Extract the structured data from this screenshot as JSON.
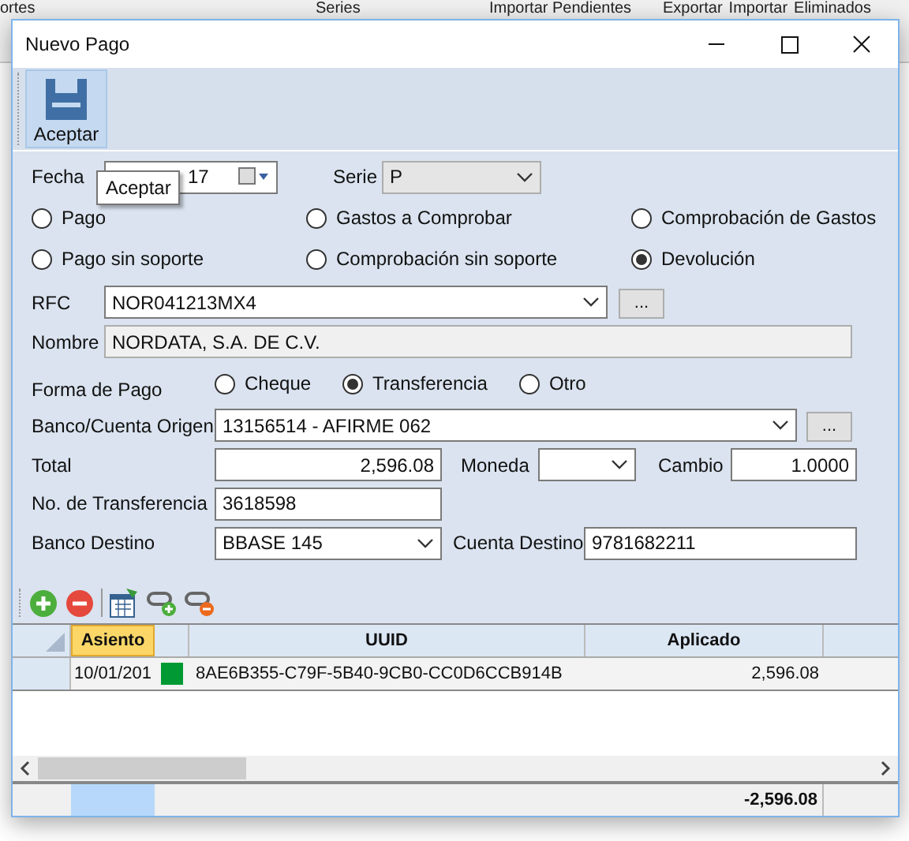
{
  "background": {
    "toolbar": [
      "ortes",
      "Series",
      "Importar Pendientes",
      "Exportar",
      "Importar",
      "Eliminados"
    ]
  },
  "window": {
    "title": "Nuevo Pago"
  },
  "toolbar": {
    "buttons": [
      {
        "label": "Aceptar"
      }
    ],
    "tooltip": "Aceptar"
  },
  "fecha": {
    "label": "Fecha",
    "value": "17"
  },
  "serie": {
    "label": "Serie",
    "value": "P"
  },
  "tipo_options": [
    {
      "label": "Pago",
      "selected": false
    },
    {
      "label": "Gastos a Comprobar",
      "selected": false
    },
    {
      "label": "Comprobación de Gastos",
      "selected": false
    },
    {
      "label": "Pago sin soporte",
      "selected": false
    },
    {
      "label": "Comprobación sin soporte",
      "selected": false
    },
    {
      "label": "Devolución",
      "selected": true
    }
  ],
  "rfc": {
    "label": "RFC",
    "value": "NOR041213MX4",
    "button": "..."
  },
  "nombre": {
    "label": "Nombre",
    "value": "NORDATA, S.A. DE C.V."
  },
  "forma_de_pago": {
    "label": "Forma de Pago",
    "options": [
      {
        "label": "Cheque",
        "selected": false
      },
      {
        "label": "Transferencia",
        "selected": true
      },
      {
        "label": "Otro",
        "selected": false
      }
    ]
  },
  "banco_origen": {
    "label": "Banco/Cuenta Origen",
    "value": "13156514 - AFIRME  062",
    "button": "..."
  },
  "total": {
    "label": "Total",
    "value": "2,596.08"
  },
  "moneda": {
    "label": "Moneda"
  },
  "cambio": {
    "label": "Cambio",
    "value": "1.0000"
  },
  "no_transferencia": {
    "label": "No. de Transferencia",
    "value": "3618598"
  },
  "banco_destino": {
    "label": "Banco Destino",
    "value": "BBASE  145"
  },
  "cuenta_destino": {
    "label": "Cuenta Destino",
    "value": "9781682211"
  },
  "grid": {
    "columns": [
      {
        "label": "Asiento",
        "selected": true
      },
      {
        "label": "UUID",
        "selected": false
      },
      {
        "label": "Aplicado",
        "selected": false
      }
    ],
    "rows": [
      {
        "asiento": "10/01/201",
        "color": "#009933",
        "uuid": "8AE6B355-C79F-5B40-9CB0-CC0D6CCB914B",
        "aplicado": "2,596.08"
      }
    ],
    "footer_total": "-2,596.08"
  }
}
